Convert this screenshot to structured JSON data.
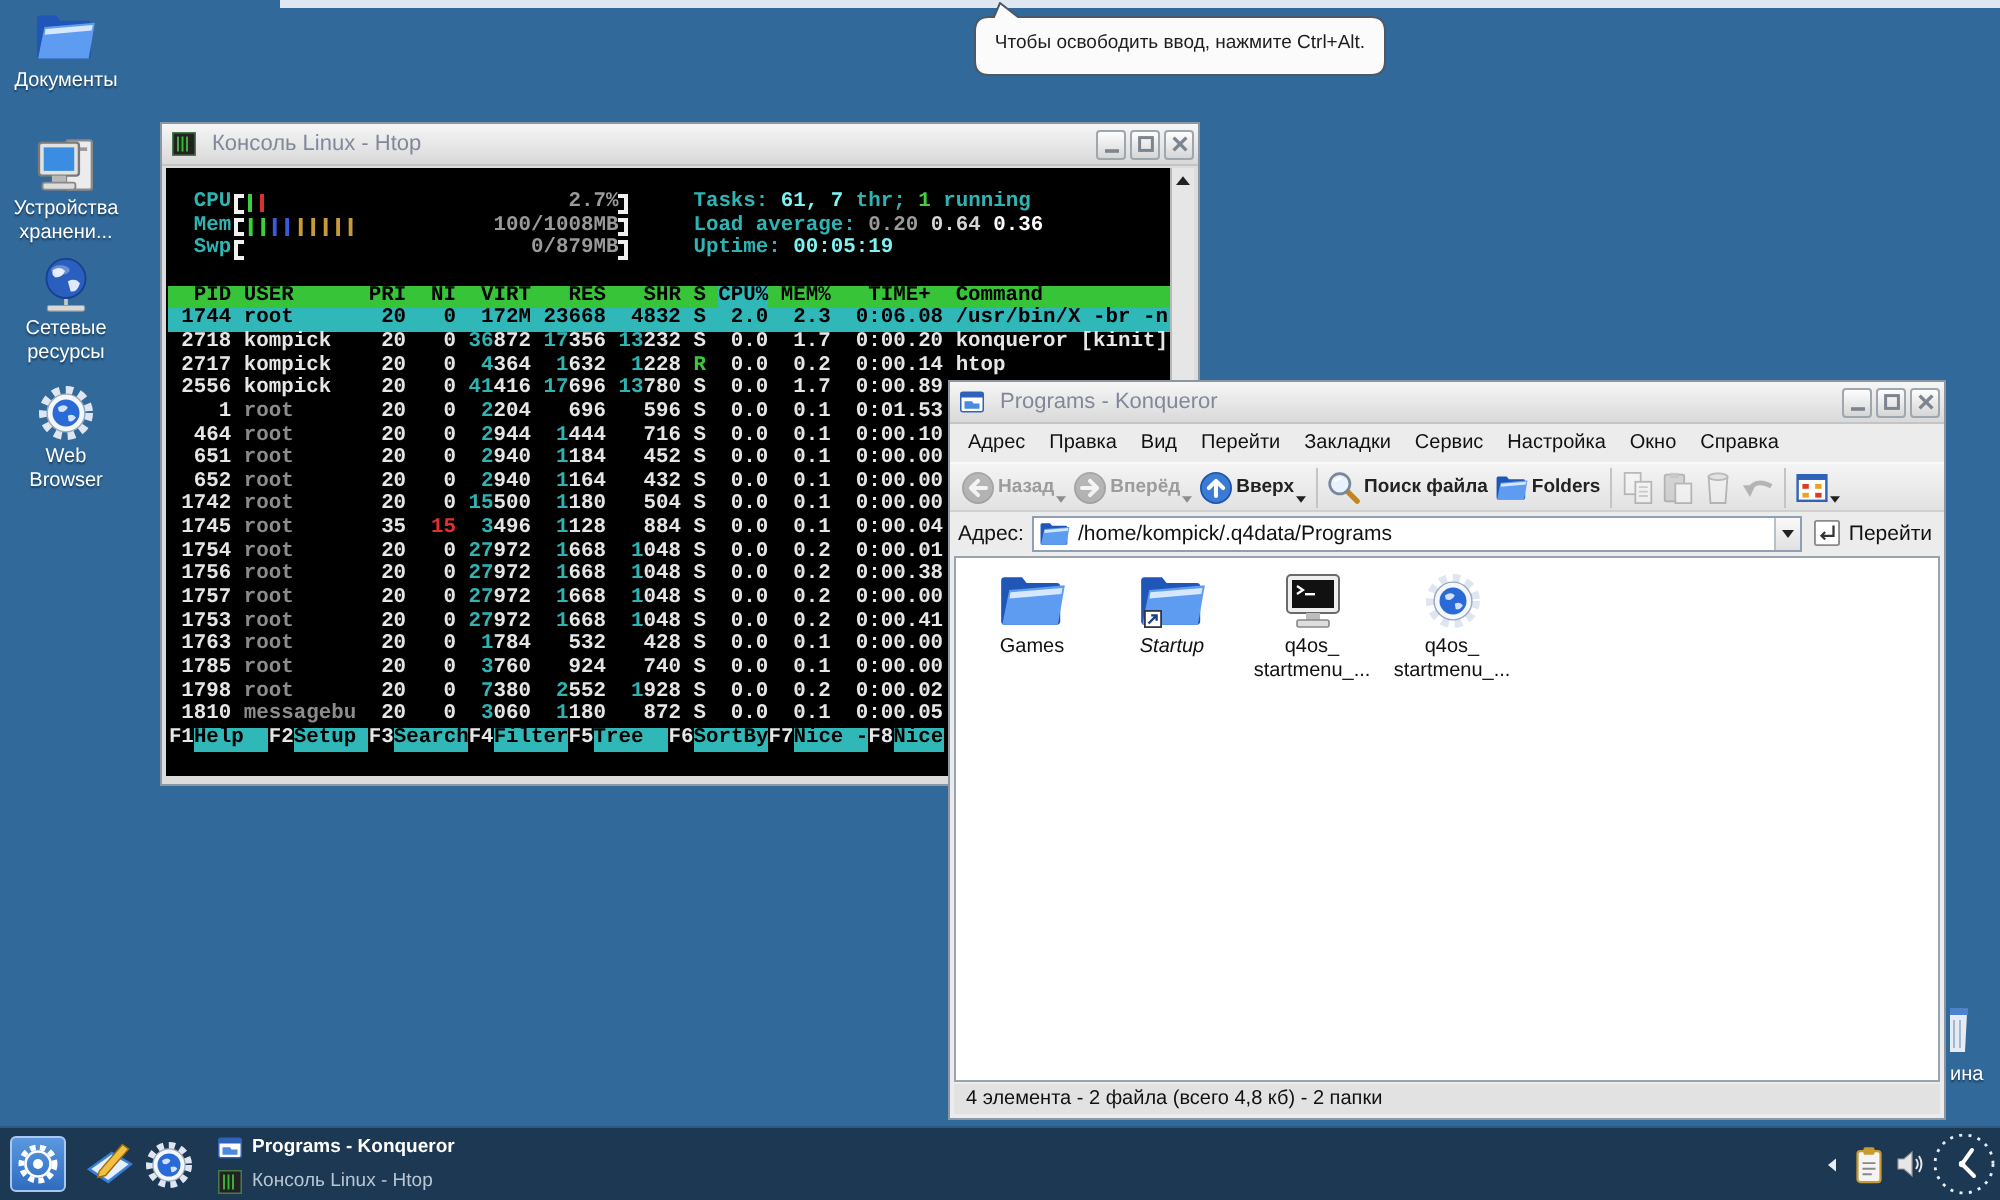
{
  "tooltip": {
    "text": "Чтобы освободить ввод, нажмите Ctrl+Alt."
  },
  "desktop_icons": [
    {
      "label": "Документы",
      "kind": "folder"
    },
    {
      "label": "Устройства хранени...",
      "kind": "computer"
    },
    {
      "label": "Сетевые ресурсы",
      "kind": "network"
    },
    {
      "label": "Web Browser",
      "kind": "browser"
    }
  ],
  "partial_desktop_icon": {
    "label": "ина",
    "kind": "trash"
  },
  "terminal_window": {
    "title": "Консоль Linux - Htop",
    "meters": [
      {
        "label": "CPU",
        "segments": [
          {
            "color": "#3ccf3c",
            "level": 0.03
          },
          {
            "color": "#d83030",
            "level": 0.03
          }
        ],
        "reading": "2.7%"
      },
      {
        "label": "Mem",
        "segments": [
          {
            "color": "#3ccf3c",
            "level": 0.07
          },
          {
            "color": "#3a5ad8",
            "level": 0.07
          },
          {
            "color": "#c89a38",
            "level": 0.17
          }
        ],
        "reading": "100/1008MB"
      },
      {
        "label": "Swp",
        "reading": "0/879MB"
      }
    ],
    "summary": [
      {
        "parts": [
          {
            "text": "Tasks:",
            "kind": "label"
          },
          {
            "text": "61,",
            "kind": "value"
          },
          {
            "text": "7",
            "kind": "value"
          },
          {
            "text": "thr;",
            "kind": "label"
          },
          {
            "text": "1",
            "kind": "running"
          },
          {
            "text": "running",
            "kind": "label"
          }
        ]
      },
      {
        "parts": [
          {
            "text": "Load average:",
            "kind": "label"
          },
          {
            "text": "0.20",
            "kind": "dim"
          },
          {
            "text": "0.64",
            "kind": "plain"
          },
          {
            "text": "0.36",
            "kind": "bold"
          }
        ]
      },
      {
        "parts": [
          {
            "text": "Uptime:",
            "kind": "label"
          },
          {
            "text": "00:05:19",
            "kind": "value"
          }
        ]
      }
    ],
    "columns": [
      {
        "label": "PID",
        "selected": false
      },
      {
        "label": "USER",
        "selected": false
      },
      {
        "label": "PRI",
        "selected": false
      },
      {
        "label": "NI",
        "selected": false
      },
      {
        "label": "VIRT",
        "selected": false
      },
      {
        "label": "RES",
        "selected": false
      },
      {
        "label": "SHR",
        "selected": false
      },
      {
        "label": "S",
        "selected": false
      },
      {
        "label": "CPU%",
        "selected": true
      },
      {
        "label": "MEM%",
        "selected": false
      },
      {
        "label": "TIME+",
        "selected": false
      },
      {
        "label": "Command",
        "selected": false
      }
    ],
    "processes": [
      {
        "cells": [
          "1744",
          "root",
          "20",
          "0",
          "172M",
          "23668",
          "4832",
          "S",
          "2.0",
          "2.3",
          "0:06.08",
          "/usr/bin/X -br -n"
        ],
        "selected": true,
        "dimmed": false,
        "niced": false,
        "running": false
      },
      {
        "cells": [
          "2718",
          "kompick",
          "20",
          "0",
          "**36**872",
          "**17**356",
          "**13**232",
          "S",
          "0.0",
          "1.7",
          "0:00.20",
          "konqueror [kinit]"
        ],
        "selected": false,
        "dimmed": false,
        "niced": false,
        "running": false
      },
      {
        "cells": [
          "2717",
          "kompick",
          "20",
          "0",
          "**4**364",
          "**1**632",
          "**1**228",
          "R",
          "0.0",
          "0.2",
          "0:00.14",
          "htop"
        ],
        "selected": false,
        "dimmed": false,
        "niced": false,
        "running": true
      },
      {
        "cells": [
          "2556",
          "kompick",
          "20",
          "0",
          "**41**416",
          "**17**696",
          "**13**780",
          "S",
          "0.0",
          "1.7",
          "0:00.89"
        ],
        "selected": false,
        "dimmed": false,
        "niced": false,
        "running": false
      },
      {
        "cells": [
          "1",
          "root",
          "20",
          "0",
          "**2**204",
          "696",
          "596",
          "S",
          "0.0",
          "0.1",
          "0:01.53"
        ],
        "selected": false,
        "dimmed": true,
        "niced": false,
        "running": false
      },
      {
        "cells": [
          "464",
          "root",
          "20",
          "0",
          "**2**944",
          "**1**444",
          "716",
          "S",
          "0.0",
          "0.1",
          "0:00.10"
        ],
        "selected": false,
        "dimmed": true,
        "niced": false,
        "running": false
      },
      {
        "cells": [
          "651",
          "root",
          "20",
          "0",
          "**2**940",
          "**1**184",
          "452",
          "S",
          "0.0",
          "0.1",
          "0:00.00"
        ],
        "selected": false,
        "dimmed": true,
        "niced": false,
        "running": false
      },
      {
        "cells": [
          "652",
          "root",
          "20",
          "0",
          "**2**940",
          "**1**164",
          "432",
          "S",
          "0.0",
          "0.1",
          "0:00.00"
        ],
        "selected": false,
        "dimmed": true,
        "niced": false,
        "running": false
      },
      {
        "cells": [
          "1742",
          "root",
          "20",
          "0",
          "**15**500",
          "**1**180",
          "504",
          "S",
          "0.0",
          "0.1",
          "0:00.00"
        ],
        "selected": false,
        "dimmed": true,
        "niced": false,
        "running": false
      },
      {
        "cells": [
          "1745",
          "root",
          "35",
          "15",
          "**3**496",
          "**1**128",
          "884",
          "S",
          "0.0",
          "0.1",
          "0:00.04"
        ],
        "selected": false,
        "dimmed": true,
        "niced": true,
        "running": false
      },
      {
        "cells": [
          "1754",
          "root",
          "20",
          "0",
          "**27**972",
          "**1**668",
          "**1**048",
          "S",
          "0.0",
          "0.2",
          "0:00.01"
        ],
        "selected": false,
        "dimmed": true,
        "niced": false,
        "running": false
      },
      {
        "cells": [
          "1756",
          "root",
          "20",
          "0",
          "**27**972",
          "**1**668",
          "**1**048",
          "S",
          "0.0",
          "0.2",
          "0:00.38"
        ],
        "selected": false,
        "dimmed": true,
        "niced": false,
        "running": false
      },
      {
        "cells": [
          "1757",
          "root",
          "20",
          "0",
          "**27**972",
          "**1**668",
          "**1**048",
          "S",
          "0.0",
          "0.2",
          "0:00.00"
        ],
        "selected": false,
        "dimmed": true,
        "niced": false,
        "running": false
      },
      {
        "cells": [
          "1753",
          "root",
          "20",
          "0",
          "**27**972",
          "**1**668",
          "**1**048",
          "S",
          "0.0",
          "0.2",
          "0:00.41"
        ],
        "selected": false,
        "dimmed": true,
        "niced": false,
        "running": false
      },
      {
        "cells": [
          "1763",
          "root",
          "20",
          "0",
          "**1**784",
          "532",
          "428",
          "S",
          "0.0",
          "0.1",
          "0:00.00"
        ],
        "selected": false,
        "dimmed": true,
        "niced": false,
        "running": false
      },
      {
        "cells": [
          "1785",
          "root",
          "20",
          "0",
          "**3**760",
          "924",
          "740",
          "S",
          "0.0",
          "0.1",
          "0:00.00"
        ],
        "selected": false,
        "dimmed": true,
        "niced": false,
        "running": false
      },
      {
        "cells": [
          "1798",
          "root",
          "20",
          "0",
          "**7**380",
          "**2**552",
          "**1**928",
          "S",
          "0.0",
          "0.2",
          "0:00.02"
        ],
        "selected": false,
        "dimmed": true,
        "niced": false,
        "running": false
      },
      {
        "cells": [
          "1810",
          "messagebu",
          "20",
          "0",
          "**3**060",
          "**1**180",
          "872",
          "S",
          "0.0",
          "0.1",
          "0:00.05"
        ],
        "selected": false,
        "dimmed": true,
        "niced": false,
        "running": false
      }
    ],
    "function_keys": [
      {
        "key": "F1",
        "label": "Help"
      },
      {
        "key": "F2",
        "label": "Setup"
      },
      {
        "key": "F3",
        "label": "Search"
      },
      {
        "key": "F4",
        "label": "Filter"
      },
      {
        "key": "F5",
        "label": "Tree"
      },
      {
        "key": "F6",
        "label": "SortBy"
      },
      {
        "key": "F7",
        "label": "Nice -"
      },
      {
        "key": "F8",
        "label": "Nice"
      }
    ]
  },
  "file_manager": {
    "title": "Programs - Konqueror",
    "menu": [
      "Адрес",
      "Правка",
      "Вид",
      "Перейти",
      "Закладки",
      "Сервис",
      "Настройка",
      "Окно",
      "Справка"
    ],
    "toolbar": [
      [
        {
          "kind": "back",
          "label": "Назад",
          "disabled": true,
          "dropdown": true
        },
        {
          "kind": "forward",
          "label": "Вперёд",
          "disabled": true,
          "dropdown": true
        },
        {
          "kind": "up",
          "label": "Вверх",
          "disabled": false,
          "dropdown": true
        }
      ],
      [
        {
          "kind": "search",
          "label": "Поиск файла",
          "disabled": false,
          "dropdown": false
        },
        {
          "kind": "folders",
          "label": "Folders",
          "disabled": false,
          "dropdown": false
        }
      ],
      [
        {
          "kind": "copy",
          "disabled": true,
          "dropdown": false
        },
        {
          "kind": "paste",
          "disabled": true,
          "dropdown": false
        },
        {
          "kind": "delete",
          "disabled": true,
          "dropdown": false
        },
        {
          "kind": "undo",
          "disabled": true,
          "dropdown": false
        }
      ],
      [
        {
          "kind": "view",
          "disabled": false,
          "dropdown": true
        }
      ]
    ],
    "address": {
      "label": "Адрес:",
      "value": "/home/kompick/.q4data/Programs",
      "go": "Перейти"
    },
    "files": [
      {
        "label": "Games",
        "kind": "folder",
        "link": false
      },
      {
        "label": "Startup",
        "kind": "folder",
        "link": true
      },
      {
        "label": "q4os_ startmenu_...",
        "kind": "terminal",
        "link": false
      },
      {
        "label": "q4os_ startmenu_...",
        "kind": "browser",
        "link": false
      }
    ],
    "status": "4 элемента - 2 файла (всего 4,8 кб) - 2 папки"
  },
  "taskbar": {
    "tasks": [
      {
        "title": "Programs - Konqueror",
        "kind": "filemanager",
        "selected": true
      },
      {
        "title": "Консоль Linux - Htop",
        "kind": "terminal",
        "selected": false
      }
    ]
  }
}
